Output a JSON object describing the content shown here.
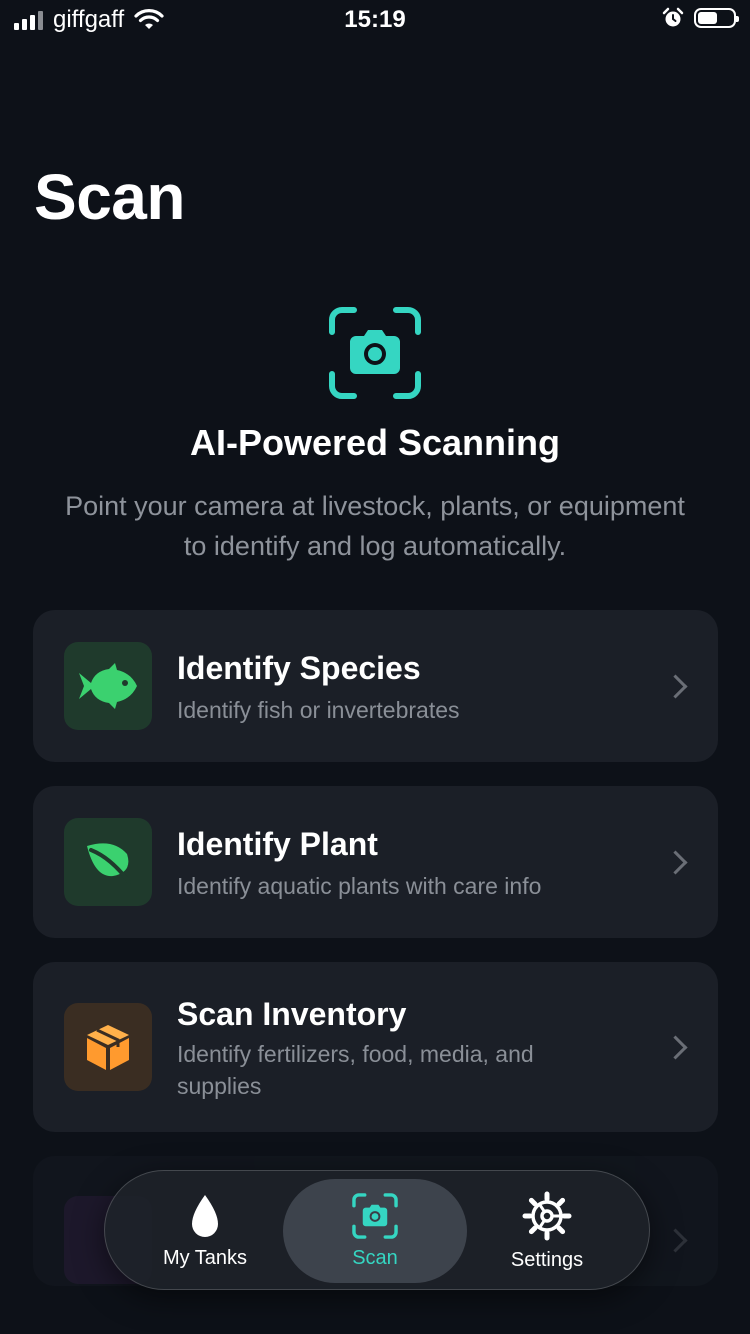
{
  "status_bar": {
    "carrier": "giffgaff",
    "time": "15:19",
    "signal_bars": 3,
    "battery_level": 0.55,
    "icons": [
      "signal-icon",
      "wifi-icon",
      "alarm-icon",
      "battery-icon"
    ]
  },
  "page": {
    "title": "Scan"
  },
  "hero": {
    "icon": "camera-scan-icon",
    "title": "AI-Powered Scanning",
    "subtitle": "Point your camera at livestock, plants, or equipment to identify and log automatically."
  },
  "cards": [
    {
      "icon": "fish-icon",
      "title": "Identify Species",
      "subtitle": "Identify fish or invertebrates",
      "accent": "#3bd16f"
    },
    {
      "icon": "leaf-icon",
      "title": "Identify Plant",
      "subtitle": "Identify aquatic plants with care info",
      "accent": "#3bd16f"
    },
    {
      "icon": "box-icon",
      "title": "Scan Inventory",
      "subtitle": "Identify fertilizers, food, media, and supplies",
      "accent": "#ff9a2e"
    }
  ],
  "tab_bar": {
    "tabs": [
      {
        "label": "My Tanks",
        "icon": "water-drop-icon",
        "selected": false
      },
      {
        "label": "Scan",
        "icon": "camera-scan-icon",
        "selected": true
      },
      {
        "label": "Settings",
        "icon": "gear-icon",
        "selected": false
      }
    ]
  },
  "colors": {
    "background": "#0d1118",
    "card": "#1b1f27",
    "accent_teal": "#35d6c2",
    "muted_text": "#8e939b"
  }
}
